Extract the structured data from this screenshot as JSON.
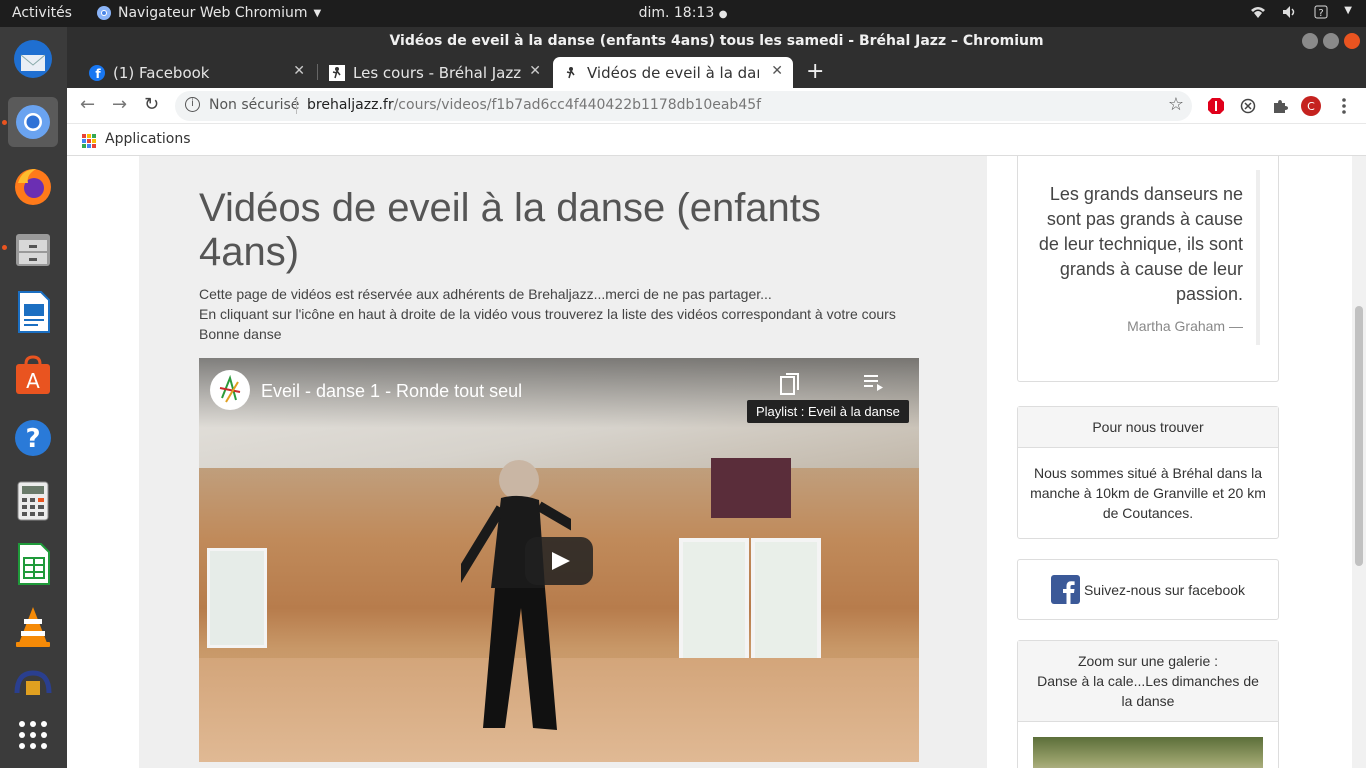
{
  "topbar": {
    "activities": "Activités",
    "app_name": "Navigateur Web Chromium",
    "clock": "dim. 18:13"
  },
  "window": {
    "title": "Vidéos de eveil à la danse (enfants 4ans) tous les samedi - Bréhal Jazz – Chromium"
  },
  "tabs": [
    {
      "label": "(1) Facebook"
    },
    {
      "label": "Les cours - Bréhal Jazz"
    },
    {
      "label": "Vidéos de eveil à la danse"
    }
  ],
  "omnibox": {
    "security": "Non sécurisé",
    "domain": "brehaljazz.fr",
    "path": "/cours/videos/f1b7ad6cc4f440422b1178db10eab45f"
  },
  "bookmarks": {
    "apps_label": "Applications"
  },
  "page": {
    "title": "Vidéos de eveil à la danse (enfants 4ans)",
    "intro_lines": [
      "Cette page de vidéos est réservée aux adhérents de Brehaljazz...merci de ne pas partager...",
      "En cliquant sur l'icône en haut à droite de la vidéo vous trouverez la liste des vidéos correspondant à votre cours",
      "Bonne danse"
    ],
    "video": {
      "title": "Eveil - danse 1 - Ronde tout seul",
      "tooltip": "Playlist : Eveil à la danse"
    }
  },
  "sidebar": {
    "quote": {
      "text": "Les grands danseurs ne sont pas grands à cause de leur technique, ils sont grands à cause de leur passion.",
      "author": "Martha Graham  —"
    },
    "find": {
      "heading": "Pour nous trouver",
      "body": "Nous sommes situé à Bréhal dans la manche à 10km de Granville et 20 km de Coutances."
    },
    "facebook": {
      "label": "Suivez-nous sur facebook"
    },
    "gallery": {
      "heading_line1": "Zoom sur une galerie :",
      "heading_line2": "Danse à la cale...Les dimanches de la danse"
    }
  },
  "colors": {
    "ubuntu_orange": "#e95420",
    "facebook_blue": "#3b5998",
    "page_bg": "#efefef"
  }
}
